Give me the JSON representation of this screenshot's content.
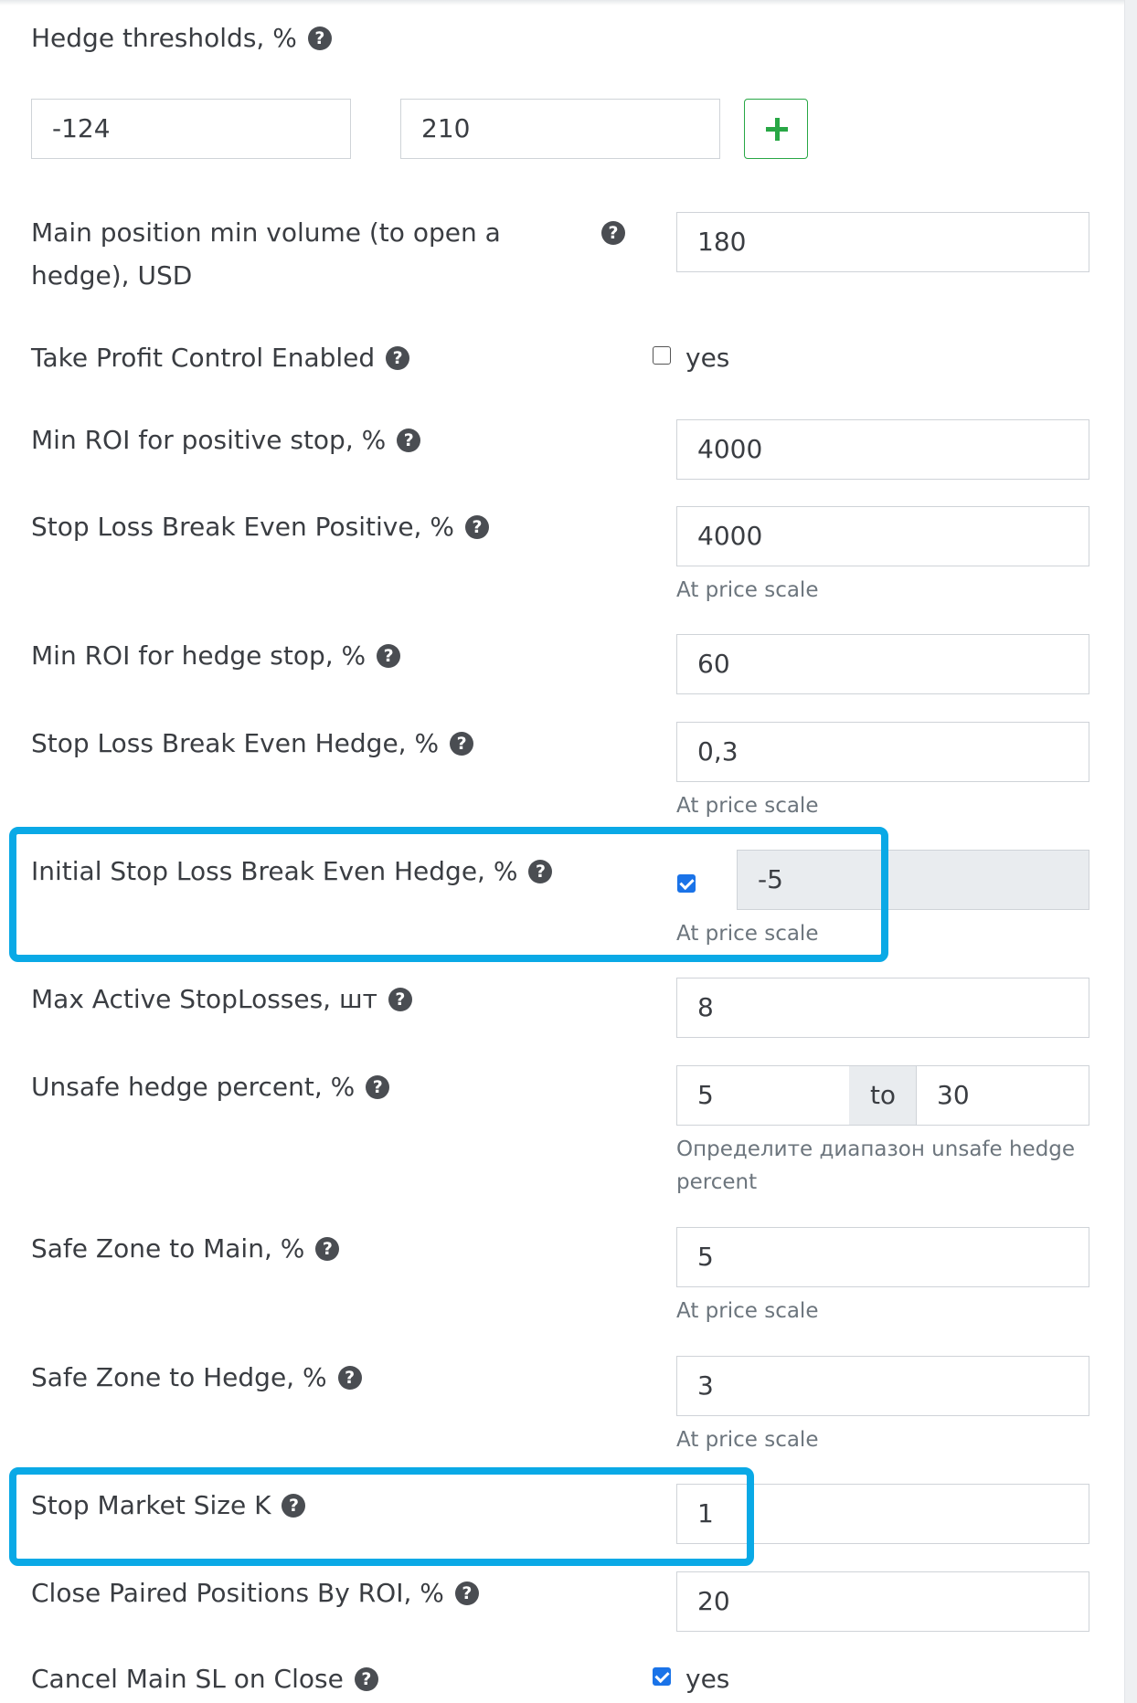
{
  "hedge_thresholds": {
    "label": "Hedge thresholds, %",
    "value1": "-124",
    "value2": "210",
    "add_icon": "plus-icon"
  },
  "main_position_min_volume": {
    "label_line1": "Main position min volume (to open a",
    "label_line2": "hedge), USD",
    "value": "180"
  },
  "take_profit_control": {
    "label": "Take Profit Control Enabled",
    "checkbox_label": "yes",
    "checked": false
  },
  "min_roi_positive_stop": {
    "label": "Min ROI for positive stop, %",
    "value": "4000"
  },
  "sl_break_even_positive": {
    "label": "Stop Loss Break Even Positive, %",
    "value": "4000",
    "hint": "At price scale"
  },
  "min_roi_hedge_stop": {
    "label": "Min ROI for hedge stop, %",
    "value": "60"
  },
  "sl_break_even_hedge": {
    "label": "Stop Loss Break Even Hedge, %",
    "value": "0,3",
    "hint": "At price scale"
  },
  "initial_sl_break_even_hedge": {
    "label": "Initial Stop Loss Break Even Hedge, %",
    "checked": true,
    "value": "-5",
    "hint": "At price scale"
  },
  "max_active_stoplosses": {
    "label": "Max Active StopLosses, шт",
    "value": "8"
  },
  "unsafe_hedge_percent": {
    "label": "Unsafe hedge percent, %",
    "from": "5",
    "to_label": "to",
    "to": "30",
    "hint_line1": "Определите диапазон unsafe hedge",
    "hint_line2": "percent"
  },
  "safe_zone_main": {
    "label": "Safe Zone to Main, %",
    "value": "5",
    "hint": "At price scale"
  },
  "safe_zone_hedge": {
    "label": "Safe Zone to Hedge, %",
    "value": "3",
    "hint": "At price scale"
  },
  "stop_market_size_k": {
    "label": "Stop Market Size K",
    "value": "1"
  },
  "close_paired_positions": {
    "label": "Close Paired Positions By ROI, %",
    "value": "20"
  },
  "cancel_main_sl": {
    "label": "Cancel Main SL on Close",
    "checkbox_label": "yes",
    "checked": true
  },
  "help_icon": "question-circle-icon",
  "colors": {
    "highlight": "#0aa9e6",
    "success": "#28a745",
    "checkbox": "#1a73e8"
  }
}
